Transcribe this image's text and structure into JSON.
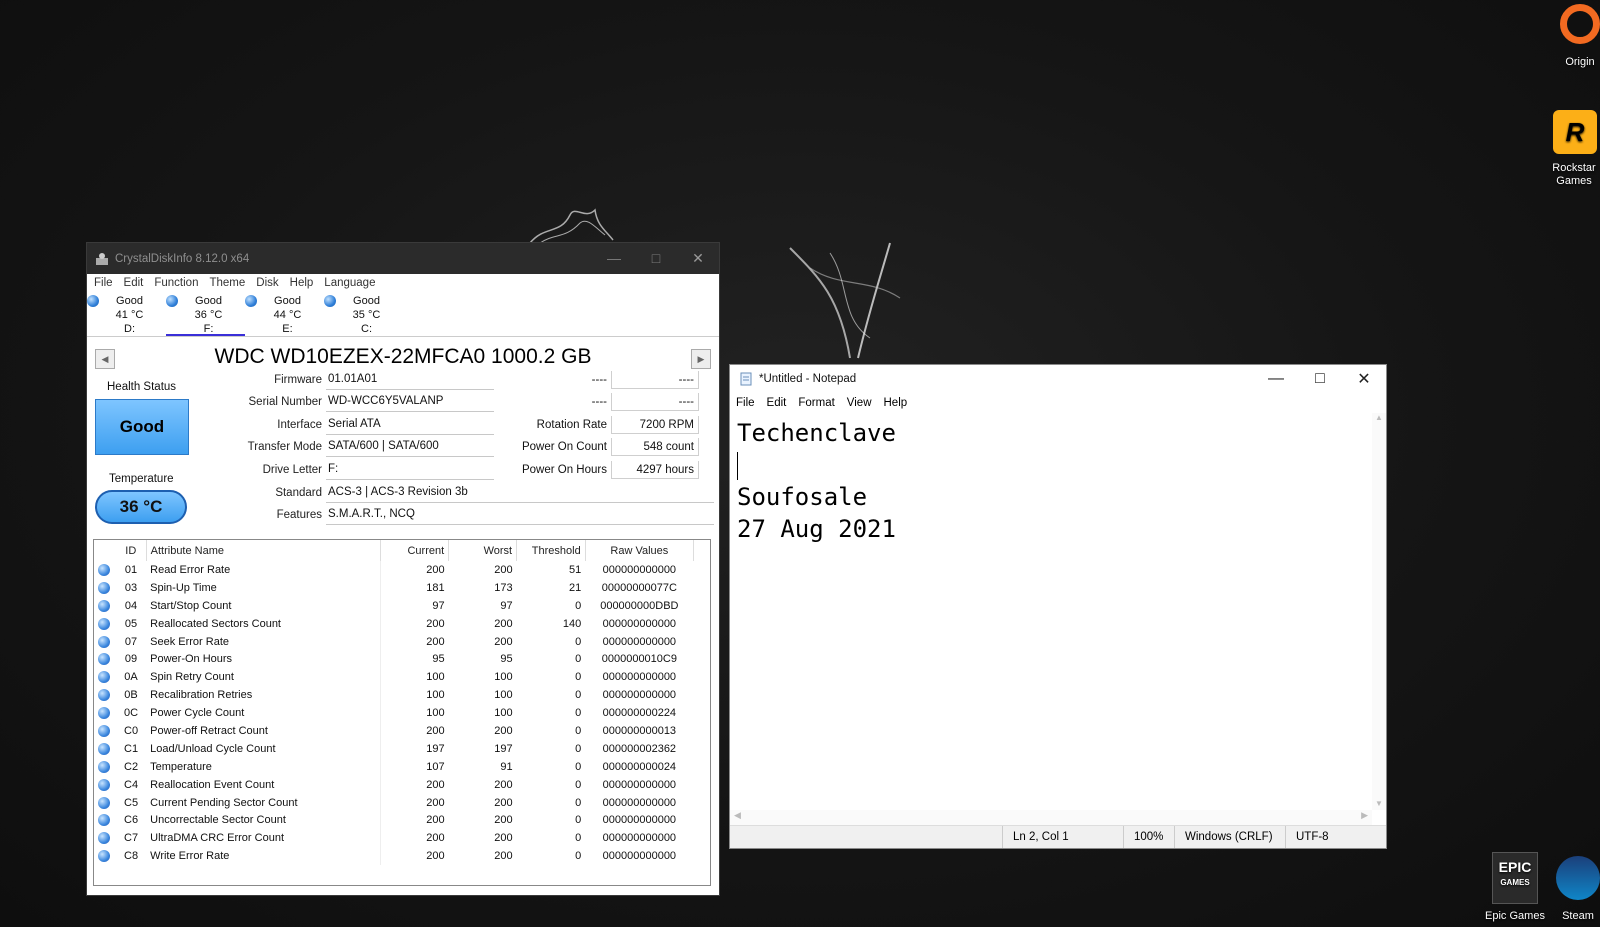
{
  "desktop": {
    "icons": [
      {
        "label": "Origin"
      },
      {
        "label": "Rockstar Games"
      },
      {
        "label": "Epic Games"
      },
      {
        "label": "Steam"
      }
    ]
  },
  "cdi": {
    "title": "CrystalDiskInfo 8.12.0 x64",
    "menu": [
      "File",
      "Edit",
      "Function",
      "Theme",
      "Disk",
      "Help",
      "Language"
    ],
    "drives": [
      {
        "status": "Good",
        "temp": "41 °C",
        "letter": "D:"
      },
      {
        "status": "Good",
        "temp": "36 °C",
        "letter": "F:"
      },
      {
        "status": "Good",
        "temp": "44 °C",
        "letter": "E:"
      },
      {
        "status": "Good",
        "temp": "35 °C",
        "letter": "C:"
      }
    ],
    "model": "WDC WD10EZEX-22MFCA0 1000.2 GB",
    "health_label": "Health Status",
    "health_value": "Good",
    "temp_label": "Temperature",
    "temp_value": "36 °C",
    "fields": {
      "firmware_label": "Firmware",
      "firmware": "01.01A01",
      "serial_label": "Serial Number",
      "serial": "WD-WCC6Y5VALANP",
      "interface_label": "Interface",
      "interface": "Serial ATA",
      "transfer_label": "Transfer Mode",
      "transfer": "SATA/600 | SATA/600",
      "drive_letter_label": "Drive Letter",
      "drive_letter": "F:",
      "standard_label": "Standard",
      "standard": "ACS-3 | ACS-3 Revision 3b",
      "features_label": "Features",
      "features": "S.M.A.R.T., NCQ",
      "r1_label": "----",
      "r1_value": "----",
      "r2_label": "----",
      "r2_value": "----",
      "rotation_label": "Rotation Rate",
      "rotation": "7200 RPM",
      "power_count_label": "Power On Count",
      "power_count": "548 count",
      "power_hours_label": "Power On Hours",
      "power_hours": "4297 hours"
    },
    "smart_headers": [
      "ID",
      "Attribute Name",
      "Current",
      "Worst",
      "Threshold",
      "Raw Values"
    ],
    "smart": [
      [
        "01",
        "Read Error Rate",
        "200",
        "200",
        "51",
        "000000000000"
      ],
      [
        "03",
        "Spin-Up Time",
        "181",
        "173",
        "21",
        "00000000077C"
      ],
      [
        "04",
        "Start/Stop Count",
        "97",
        "97",
        "0",
        "000000000DBD"
      ],
      [
        "05",
        "Reallocated Sectors Count",
        "200",
        "200",
        "140",
        "000000000000"
      ],
      [
        "07",
        "Seek Error Rate",
        "200",
        "200",
        "0",
        "000000000000"
      ],
      [
        "09",
        "Power-On Hours",
        "95",
        "95",
        "0",
        "0000000010C9"
      ],
      [
        "0A",
        "Spin Retry Count",
        "100",
        "100",
        "0",
        "000000000000"
      ],
      [
        "0B",
        "Recalibration Retries",
        "100",
        "100",
        "0",
        "000000000000"
      ],
      [
        "0C",
        "Power Cycle Count",
        "100",
        "100",
        "0",
        "000000000224"
      ],
      [
        "C0",
        "Power-off Retract Count",
        "200",
        "200",
        "0",
        "000000000013"
      ],
      [
        "C1",
        "Load/Unload Cycle Count",
        "197",
        "197",
        "0",
        "000000002362"
      ],
      [
        "C2",
        "Temperature",
        "107",
        "91",
        "0",
        "000000000024"
      ],
      [
        "C4",
        "Reallocation Event Count",
        "200",
        "200",
        "0",
        "000000000000"
      ],
      [
        "C5",
        "Current Pending Sector Count",
        "200",
        "200",
        "0",
        "000000000000"
      ],
      [
        "C6",
        "Uncorrectable Sector Count",
        "200",
        "200",
        "0",
        "000000000000"
      ],
      [
        "C7",
        "UltraDMA CRC Error Count",
        "200",
        "200",
        "0",
        "000000000000"
      ],
      [
        "C8",
        "Write Error Rate",
        "200",
        "200",
        "0",
        "000000000000"
      ]
    ]
  },
  "notepad": {
    "title": "*Untitled - Notepad",
    "menu": [
      "File",
      "Edit",
      "Format",
      "View",
      "Help"
    ],
    "lines": [
      "Techenclave",
      "",
      "Soufosale",
      "27 Aug 2021"
    ],
    "status": {
      "pos": "Ln 2, Col 1",
      "zoom": "100%",
      "eol": "Windows (CRLF)",
      "enc": "UTF-8"
    }
  }
}
